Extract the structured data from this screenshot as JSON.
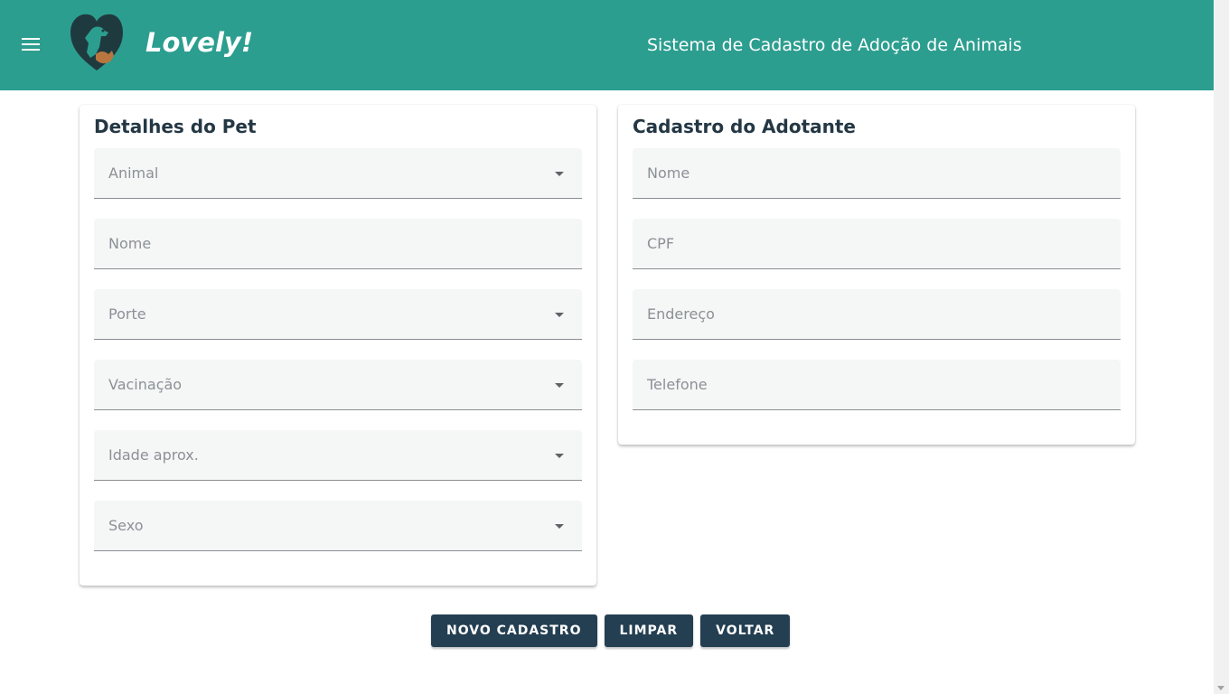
{
  "header": {
    "brand": "Lovely!",
    "title": "Sistema de Cadastro de Adoção de Animais",
    "color": "#2c9e8f"
  },
  "pet_card": {
    "title": "Detalhes do Pet",
    "fields": [
      {
        "label": "Animal",
        "type": "select"
      },
      {
        "label": "Nome",
        "type": "text"
      },
      {
        "label": "Porte",
        "type": "select"
      },
      {
        "label": "Vacinação",
        "type": "select"
      },
      {
        "label": "Idade aprox.",
        "type": "select"
      },
      {
        "label": "Sexo",
        "type": "select"
      }
    ]
  },
  "adotante_card": {
    "title": "Cadastro do Adotante",
    "fields": [
      {
        "label": "Nome",
        "type": "text"
      },
      {
        "label": "CPF",
        "type": "text"
      },
      {
        "label": "Endereço",
        "type": "text"
      },
      {
        "label": "Telefone",
        "type": "text"
      }
    ]
  },
  "actions": {
    "novo": "NOVO CADASTRO",
    "limpar": "LIMPAR",
    "voltar": "VOLTAR",
    "color": "#243f52"
  }
}
